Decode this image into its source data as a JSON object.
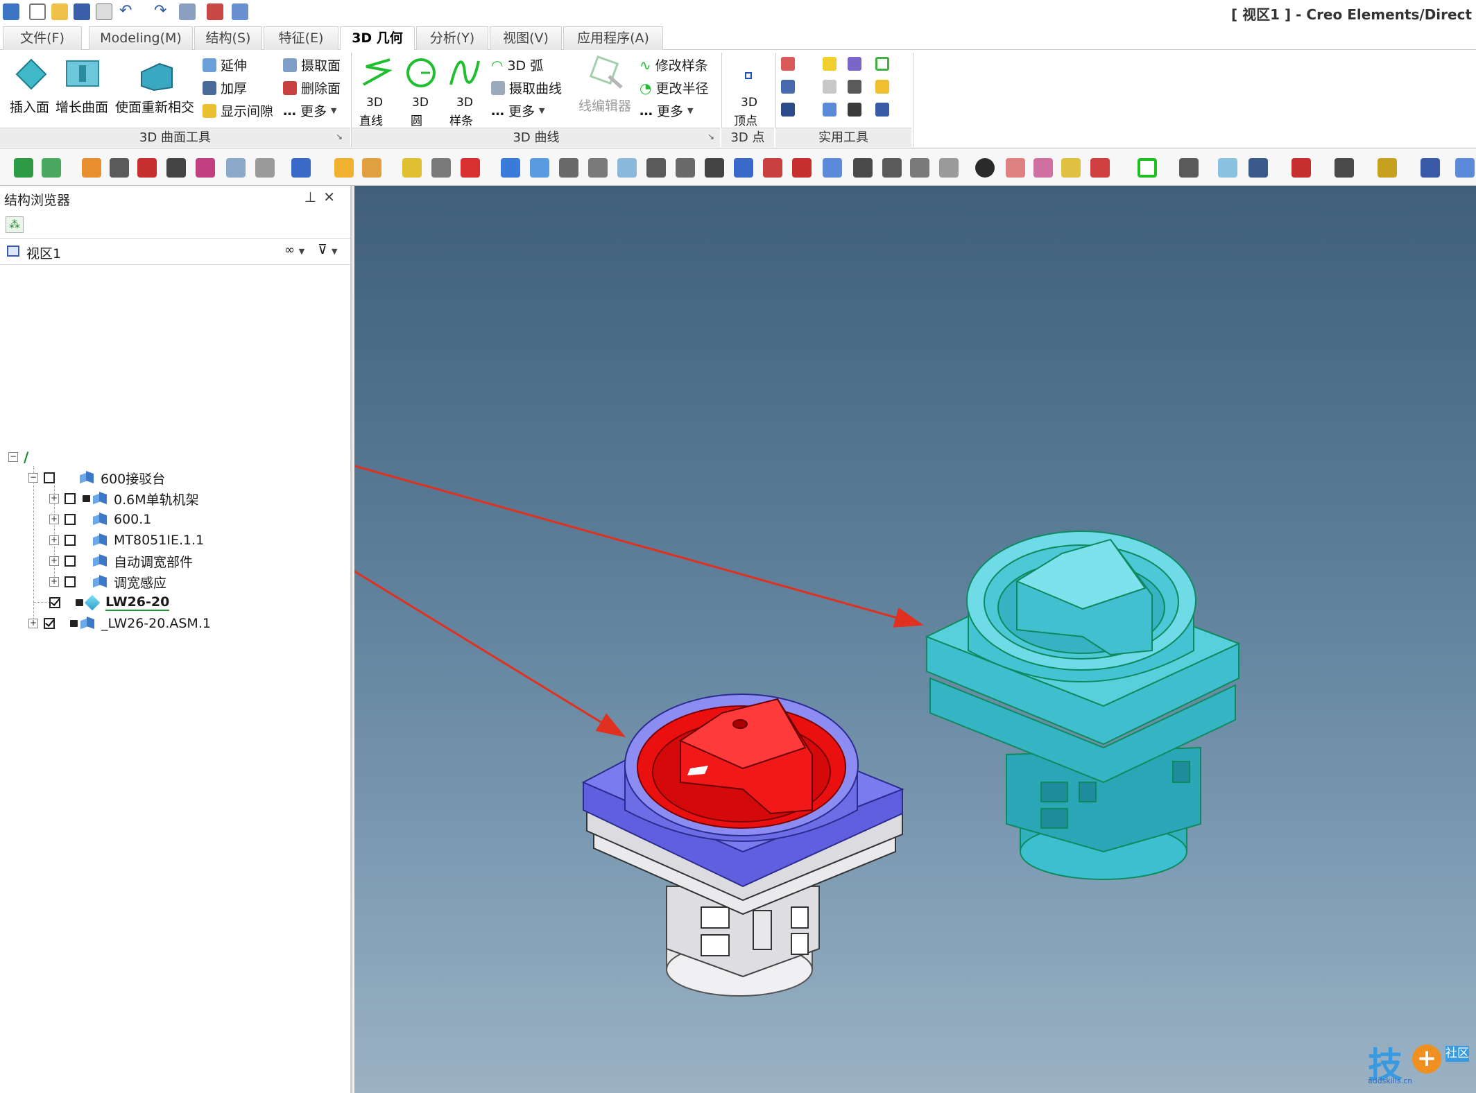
{
  "window_title": "[ 视区1 ] - Creo Elements/Direct",
  "tabs": [
    {
      "label": "文件(F)",
      "active": false
    },
    {
      "label": "Modeling(M)",
      "active": false
    },
    {
      "label": "结构(S)",
      "active": false
    },
    {
      "label": "特征(E)",
      "active": false
    },
    {
      "label": "3D 几何",
      "active": true
    },
    {
      "label": "分析(Y)",
      "active": false
    },
    {
      "label": "视图(V)",
      "active": false
    },
    {
      "label": "应用程序(A)",
      "active": false
    }
  ],
  "ribbon": {
    "surface_tools": {
      "group_label": "3D 曲面工具",
      "insert_face": "插入面",
      "grow_surface": "增长曲面",
      "reintersect": "使面重新相交",
      "extend": "延伸",
      "thicken": "加厚",
      "show_gap": "显示间隙",
      "extract_face": "摄取面",
      "delete_face": "删除面",
      "more": "更多"
    },
    "curves": {
      "group_label": "3D 曲线",
      "line_top": "3D",
      "line_bottom": "直线",
      "circle_top": "3D",
      "circle_bottom": "圆",
      "spline_top": "3D",
      "spline_bottom": "样条",
      "arc": "3D 弧",
      "extract_curve": "摄取曲线",
      "more": "更多",
      "wire_editor": "线编辑器",
      "modify_spline": "修改样条",
      "change_radius": "更改半径",
      "more2": "更多"
    },
    "points": {
      "group_label": "3D 点",
      "vertex_top": "3D",
      "vertex_bottom": "顶点"
    },
    "utilities": {
      "group_label": "实用工具"
    }
  },
  "browser": {
    "title": "结构浏览器",
    "pin_icon": "pin-icon",
    "close_icon": "close-icon",
    "view_name": "视区1",
    "tree": [
      {
        "label": "600接驳台",
        "checked": false,
        "expanded": true,
        "bold": false
      },
      {
        "label": "0.6M单轨机架",
        "checked": false,
        "expanded": false,
        "bold": false
      },
      {
        "label": "600.1",
        "checked": false,
        "expanded": false,
        "bold": false
      },
      {
        "label": "MT8051IE.1.1",
        "checked": false,
        "expanded": false,
        "bold": false
      },
      {
        "label": "自动调宽部件",
        "checked": false,
        "expanded": false,
        "bold": false
      },
      {
        "label": "调宽感应",
        "checked": false,
        "expanded": false,
        "bold": false
      },
      {
        "label": "LW26-20",
        "checked": true,
        "expanded": false,
        "bold": true
      },
      {
        "label": "_LW26-20.ASM.1",
        "checked": true,
        "expanded": false,
        "bold": false
      }
    ]
  },
  "watermark": {
    "text": "技",
    "badge": "社区",
    "url": "addskills.cn"
  },
  "colors": {
    "selected_face": "#e01010",
    "selected_body": "#6b6be8",
    "highlight_part": "#3ab7c8",
    "annotation_arrow": "#e03020"
  }
}
